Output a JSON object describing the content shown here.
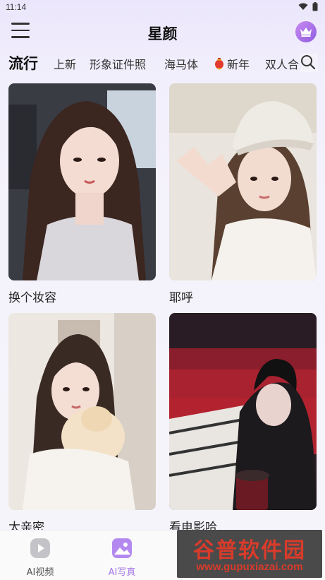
{
  "status_bar": {
    "time": "11:14"
  },
  "header": {
    "title": "星颜"
  },
  "tabs": [
    {
      "label": "流行",
      "active": true
    },
    {
      "label": "上新"
    },
    {
      "label": "形象证件照"
    },
    {
      "label": "海马体"
    },
    {
      "label": "新年",
      "icon": "lantern-icon"
    },
    {
      "label": "双人合照"
    }
  ],
  "cards": [
    {
      "caption": "换个妆容",
      "image": "selfie in car photo"
    },
    {
      "caption": "耶呼",
      "image": "girl with cap peace sign photo"
    },
    {
      "caption": "太亲密",
      "image": "girl holding cat photo"
    },
    {
      "caption": "看电影哈",
      "image": "girl in cinema photo"
    }
  ],
  "bottom_nav": [
    {
      "label": "AI视频",
      "icon": "play-icon"
    },
    {
      "label": "AI写真",
      "icon": "image-icon",
      "active": true
    }
  ],
  "watermark": {
    "title": "谷普软件园",
    "url": "www.gupuxiazai.com"
  },
  "colors": {
    "accent": "#8f5ce0",
    "nav_active": "#a77be8",
    "watermark_red": "#d93b2b"
  }
}
